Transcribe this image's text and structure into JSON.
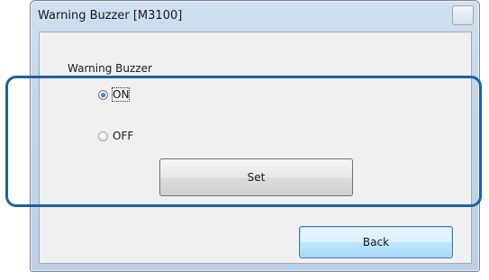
{
  "window": {
    "title": "Warning Buzzer [M3100]"
  },
  "group": {
    "label": "Warning Buzzer"
  },
  "options": [
    {
      "label": "ON",
      "selected": true
    },
    {
      "label": "OFF",
      "selected": false
    }
  ],
  "buttons": {
    "set_label": "Set",
    "back_label": "Back"
  },
  "colors": {
    "highlight_border": "#1f5fa6",
    "default_button_border": "#3c7fb1"
  }
}
